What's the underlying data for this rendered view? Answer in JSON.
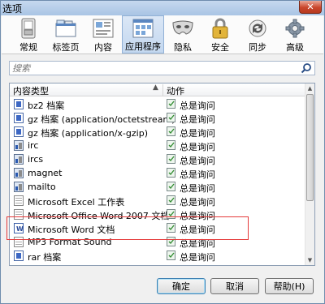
{
  "window": {
    "title": "选项",
    "close_glyph": "✕"
  },
  "toolbar": {
    "items": [
      {
        "label": "常规",
        "icon": "switch-icon"
      },
      {
        "label": "标签页",
        "icon": "tabs-icon"
      },
      {
        "label": "内容",
        "icon": "content-icon"
      },
      {
        "label": "应用程序",
        "icon": "applications-icon",
        "active": true
      },
      {
        "label": "隐私",
        "icon": "mask-icon"
      },
      {
        "label": "安全",
        "icon": "lock-icon"
      },
      {
        "label": "同步",
        "icon": "sync-icon"
      },
      {
        "label": "高级",
        "icon": "gear-icon"
      }
    ]
  },
  "search": {
    "placeholder": "搜索"
  },
  "list": {
    "col_type": "内容类型",
    "sort_glyph": "▲",
    "col_action": "动作",
    "rows": [
      {
        "type": "bz2 档案",
        "action": "总是询问",
        "icon": "archive-icon"
      },
      {
        "type": "gz 档案 (application/octetstream)",
        "action": "总是询问",
        "icon": "archive-icon"
      },
      {
        "type": "gz 档案 (application/x-gzip)",
        "action": "总是询问",
        "icon": "archive-icon"
      },
      {
        "type": "irc",
        "action": "总是询问",
        "icon": "irc-icon"
      },
      {
        "type": "ircs",
        "action": "总是询问",
        "icon": "irc-icon"
      },
      {
        "type": "magnet",
        "action": "总是询问",
        "icon": "magnet-icon"
      },
      {
        "type": "mailto",
        "action": "总是询问",
        "icon": "mail-icon"
      },
      {
        "type": "Microsoft Excel 工作表",
        "action": "总是询问",
        "icon": "excel-icon"
      },
      {
        "type": "Microsoft Office Word 2007 文档",
        "action": "总是询问",
        "icon": "word-icon"
      },
      {
        "type": "Microsoft Word 文档",
        "action": "总是询问",
        "icon": "word-icon"
      },
      {
        "type": "MP3 Format Sound",
        "action": "总是询问",
        "icon": "audio-icon"
      },
      {
        "type": "rar 档案",
        "action": "总是询问",
        "icon": "archive-icon"
      }
    ]
  },
  "buttons": {
    "ok": "确定",
    "cancel": "取消",
    "help": "帮助(H)"
  },
  "colors": {
    "highlight": "#e53b3b",
    "active_tab": "#c3d7ef",
    "titlebar": "#a9c4e4"
  }
}
